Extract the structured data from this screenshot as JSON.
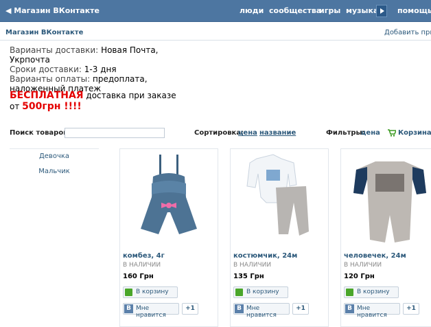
{
  "topbar": {
    "back_label": "Магазин ВКонтакте",
    "nav": [
      "люди",
      "сообщества",
      "игры",
      "музыка",
      "помощь"
    ]
  },
  "subheader": {
    "title": "Магазин ВКонтакте",
    "add_app": "Добавить прилож"
  },
  "info": {
    "delivery_label": "Варианты доставки:",
    "delivery_value": "Новая Почта, Укрпочта",
    "terms_label": "Сроки доставки:",
    "terms_value": "1-3 дня",
    "payment_label": "Варианты оплаты:",
    "payment_value": "предоплата, наложенный платеж"
  },
  "promo": {
    "free": "БЕСПЛАТНАЯ",
    "text1": " доставка при заказе",
    "from": "от ",
    "amount": "500грн !!!!"
  },
  "toolbar": {
    "search_label": "Поиск товаров:",
    "search_value": "",
    "sort_label": "Сортировка:",
    "sort_price": "цена",
    "sort_name": "название",
    "filters_label": "Фильтры:",
    "filter_price": "цена",
    "cart_label": "Корзина"
  },
  "categories": [
    "Девочка",
    "Мальчик"
  ],
  "products": [
    {
      "name": "комбез, 4г",
      "stock": "В НАЛИЧИИ",
      "price": "160  Грн",
      "cart": "В корзину",
      "like": "Мне нравится",
      "plus": "+1",
      "icon": "denim-romper-image"
    },
    {
      "name": "костюмчик, 24м",
      "stock": "В НАЛИЧИИ",
      "price": "135  Грн",
      "cart": "В корзину",
      "like": "Мне нравится",
      "plus": "+1",
      "icon": "bodysuit-pants-image"
    },
    {
      "name": "человечек, 24м",
      "stock": "В НАЛИЧИИ",
      "price": "120  Грн",
      "cart": "В корзину",
      "like": "Мне нравится",
      "plus": "+1",
      "icon": "rockstar-romper-image"
    }
  ],
  "colors": {
    "topbar": "#4d76a1",
    "link": "#2b587a",
    "promo_red": "#e40000",
    "cart_green": "#4aa62a"
  }
}
